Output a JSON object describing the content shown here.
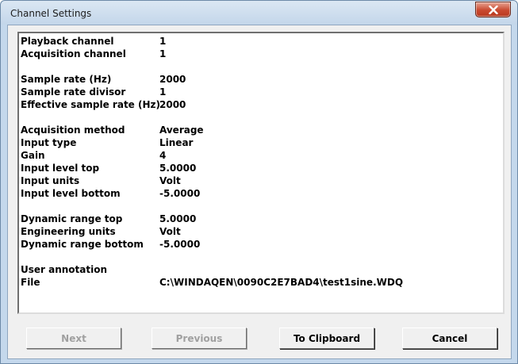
{
  "window": {
    "title": "Channel Settings"
  },
  "groups": [
    [
      {
        "label": "Playback channel",
        "value": "1"
      },
      {
        "label": "Acquisition channel",
        "value": "1"
      }
    ],
    [
      {
        "label": "Sample rate (Hz)",
        "value": "2000"
      },
      {
        "label": "Sample rate divisor",
        "value": "1"
      },
      {
        "label": "Effective sample rate (Hz)",
        "value": "2000"
      }
    ],
    [
      {
        "label": "Acquisition method",
        "value": "Average"
      },
      {
        "label": "Input type",
        "value": "Linear"
      },
      {
        "label": "Gain",
        "value": "4"
      },
      {
        "label": "Input level top",
        "value": "5.0000"
      },
      {
        "label": "Input units",
        "value": "Volt"
      },
      {
        "label": "Input level bottom",
        "value": "-5.0000"
      }
    ],
    [
      {
        "label": "Dynamic range top",
        "value": "5.0000"
      },
      {
        "label": "Engineering units",
        "value": "Volt"
      },
      {
        "label": "Dynamic range bottom",
        "value": "-5.0000"
      }
    ],
    [
      {
        "label": "User annotation",
        "value": ""
      },
      {
        "label": "File",
        "value": "C:\\WINDAQEN\\0090C2E7BAD4\\test1sine.WDQ"
      }
    ]
  ],
  "buttons": {
    "next": "Next",
    "previous": "Previous",
    "clipboard": "To Clipboard",
    "cancel": "Cancel"
  }
}
